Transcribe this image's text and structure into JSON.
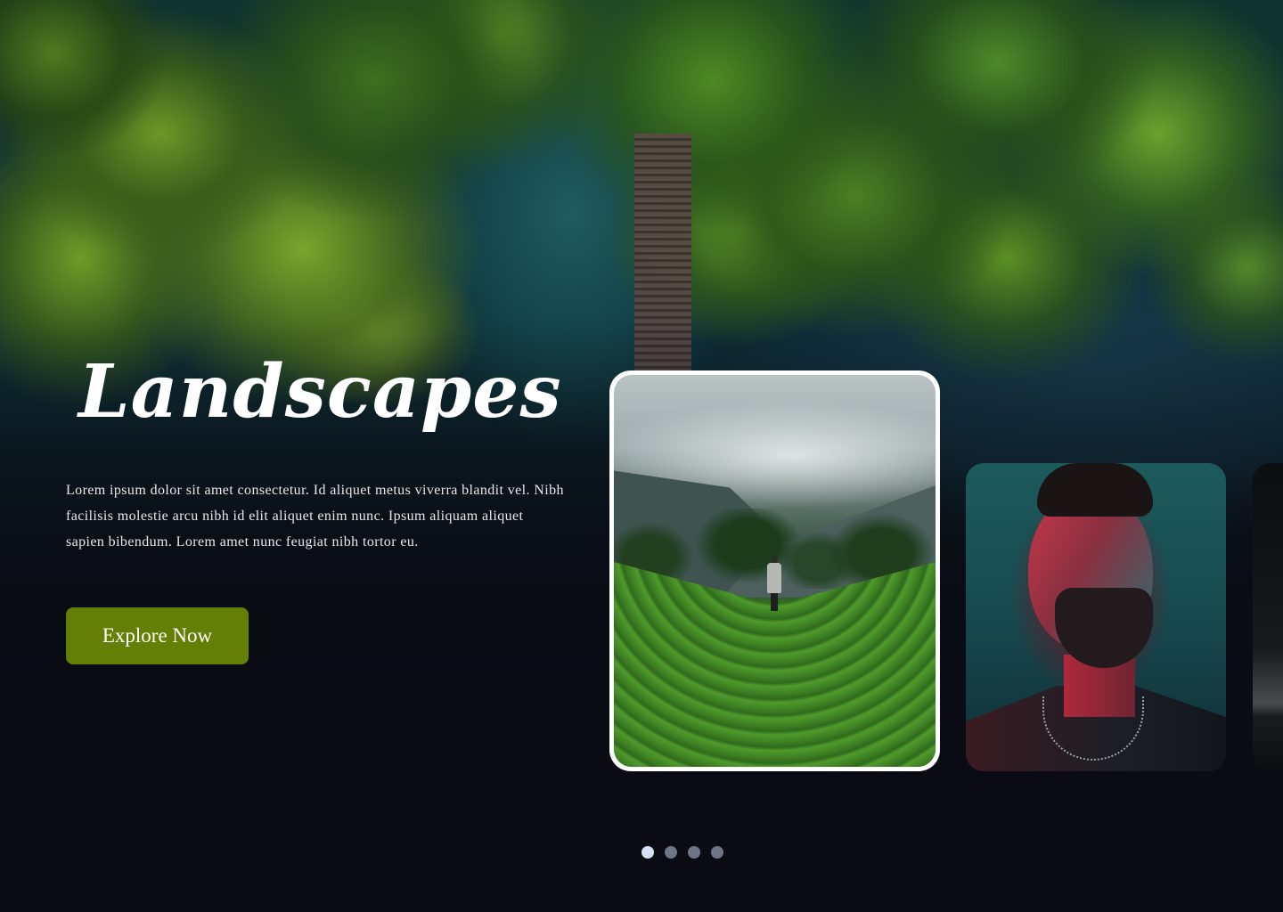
{
  "hero": {
    "title": "Landscapes",
    "description": "Lorem ipsum dolor sit amet consectetur. Id aliquet metus viverra blandit vel. Nibh facilisis molestie arcu nibh id elit aliquet enim nunc. Ipsum aliquam aliquet sapien bibendum. Lorem amet nunc feugiat nibh tortor eu.",
    "cta_label": "Explore Now"
  },
  "carousel": {
    "cards": [
      {
        "name": "landscape-card",
        "active": true
      },
      {
        "name": "portrait-card",
        "active": false
      },
      {
        "name": "dark-card",
        "active": false
      }
    ],
    "dots": [
      {
        "active": true
      },
      {
        "active": false
      },
      {
        "active": false
      },
      {
        "active": false
      }
    ]
  },
  "colors": {
    "accent": "#647f05",
    "background": "#0a0b13",
    "dot_active": "#d5e0f6",
    "dot_inactive": "#6e7585"
  }
}
